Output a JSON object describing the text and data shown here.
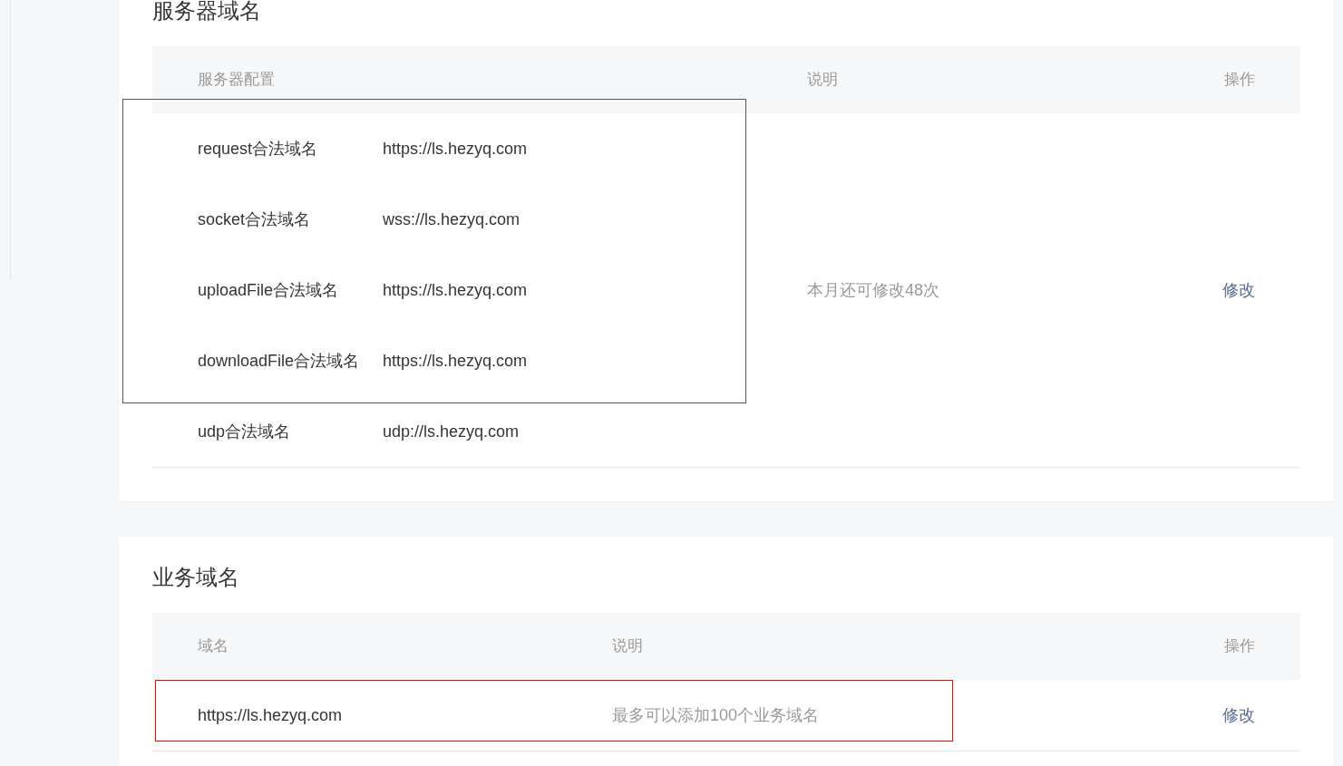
{
  "server_domains": {
    "title": "服务器域名",
    "columns": [
      "服务器配置",
      "说明",
      "操作"
    ],
    "rows": [
      {
        "label": "request合法域名",
        "value": "https://ls.hezyq.com"
      },
      {
        "label": "socket合法域名",
        "value": "wss://ls.hezyq.com"
      },
      {
        "label": "uploadFile合法域名",
        "value": "https://ls.hezyq.com"
      },
      {
        "label": "downloadFile合法域名",
        "value": "https://ls.hezyq.com"
      },
      {
        "label": "udp合法域名",
        "value": "udp://ls.hezyq.com"
      }
    ],
    "description": "本月还可修改48次",
    "action": "修改"
  },
  "business_domains": {
    "title": "业务域名",
    "columns": [
      "域名",
      "说明",
      "操作"
    ],
    "rows": [
      {
        "domain": "https://ls.hezyq.com",
        "description": "最多可以添加100个业务域名",
        "action": "修改"
      }
    ]
  },
  "highlight_frames": [
    {
      "color": "#555555"
    },
    {
      "color": "#ff0000"
    }
  ]
}
